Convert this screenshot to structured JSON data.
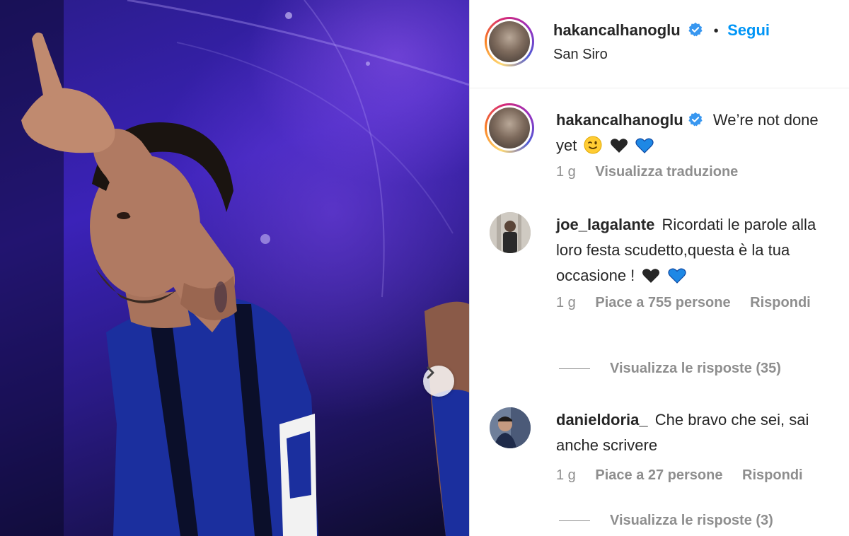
{
  "post": {
    "author": "hakancalhanoglu",
    "location": "San Siro",
    "follow_label": "Segui",
    "dot": "•"
  },
  "caption": {
    "author": "hakancalhanoglu",
    "text_part1": "We’re not done",
    "text_part2": "yet",
    "emojis": [
      "winking-face",
      "black-heart",
      "blue-heart"
    ],
    "age": "1 g",
    "translate_label": "Visualizza traduzione"
  },
  "comments": [
    {
      "author": "joe_lagalante",
      "line1": "Ricordati le parole alla",
      "line2": "loro festa scudetto,questa è la tua",
      "line3": "occasione !",
      "emojis": [
        "black-heart",
        "blue-heart"
      ],
      "age": "1 g",
      "likes_label": "Piace a 755 persone",
      "reply_label": "Rispondi",
      "view_replies": "Visualizza le risposte (35)"
    },
    {
      "author": "danieldoria_",
      "line1": "Che bravo che sei, sai",
      "line2": "anche scrivere",
      "age": "1 g",
      "likes_label": "Piace a 27 persone",
      "reply_label": "Rispondi",
      "view_replies": "Visualizza le risposte (3)"
    }
  ],
  "colors": {
    "link_blue": "#0095f6",
    "verified_blue": "#3897f0",
    "secondary_text": "#8e8e8e"
  }
}
